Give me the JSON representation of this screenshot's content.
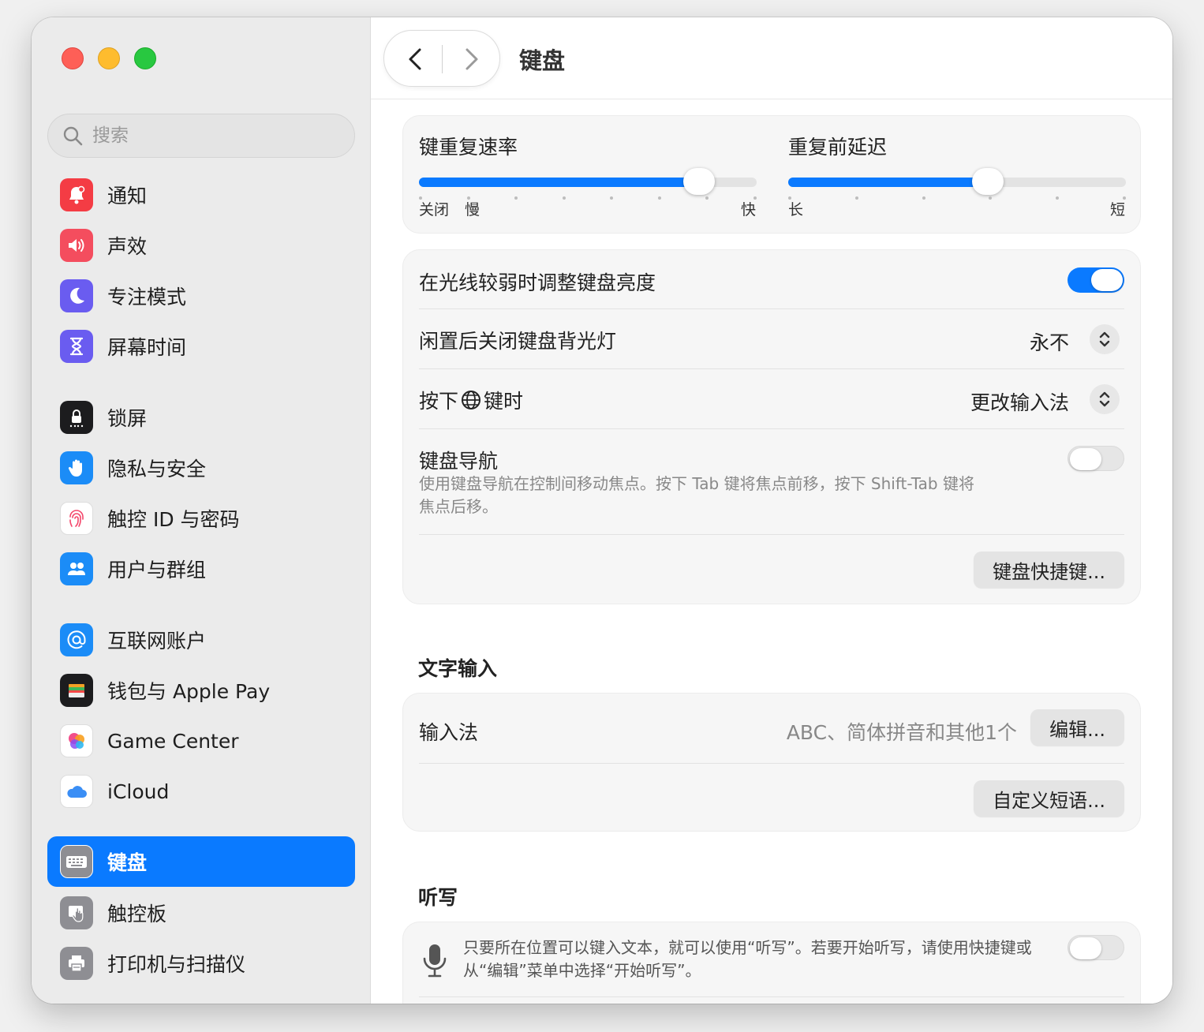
{
  "page": {
    "title": "键盘"
  },
  "search": {
    "placeholder": "搜索"
  },
  "sidebar": {
    "items": [
      {
        "label": "通知",
        "icon": "bell-icon",
        "color": "#f43c44"
      },
      {
        "label": "声效",
        "icon": "speaker-icon",
        "color": "#f44d5e"
      },
      {
        "label": "专注模式",
        "icon": "moon-icon",
        "color": "#6a5cf0"
      },
      {
        "label": "屏幕时间",
        "icon": "hourglass-icon",
        "color": "#6a5cf0"
      },
      {
        "label": "锁屏",
        "icon": "lock-icon",
        "color": "#1c1c1e"
      },
      {
        "label": "隐私与安全",
        "icon": "hand-icon",
        "color": "#1b8cf7"
      },
      {
        "label": "触控 ID 与密码",
        "icon": "fingerprint-icon",
        "color": "#ffffff"
      },
      {
        "label": "用户与群组",
        "icon": "users-icon",
        "color": "#1b8cf7"
      },
      {
        "label": "互联网账户",
        "icon": "at-icon",
        "color": "#1b8cf7"
      },
      {
        "label": "钱包与 Apple Pay",
        "icon": "wallet-icon",
        "color": "#1c1c1e"
      },
      {
        "label": "Game Center",
        "icon": "game-center-icon",
        "color": "#ffffff"
      },
      {
        "label": "iCloud",
        "icon": "cloud-icon",
        "color": "#ffffff"
      },
      {
        "label": "键盘",
        "icon": "keyboard-icon",
        "color": "#8e8e93",
        "selected": true
      },
      {
        "label": "触控板",
        "icon": "trackpad-icon",
        "color": "#8e8e93"
      },
      {
        "label": "打印机与扫描仪",
        "icon": "printer-icon",
        "color": "#8e8e93"
      }
    ]
  },
  "repeat": {
    "rate": {
      "title": "键重复速率",
      "label_off": "关闭",
      "label_slow": "慢",
      "label_fast": "快",
      "value_fraction": 0.83
    },
    "delay": {
      "title": "重复前延迟",
      "label_long": "长",
      "label_short": "短",
      "value_fraction": 0.59
    }
  },
  "settings": {
    "brightness": {
      "label": "在光线较弱时调整键盘亮度",
      "on": true
    },
    "backlight": {
      "label": "闲置后关闭键盘背光灯",
      "value": "永不"
    },
    "globe": {
      "label_before": "按下",
      "label_after": "键时",
      "value": "更改输入法"
    },
    "navigation": {
      "label": "键盘导航",
      "desc": "使用键盘导航在控制间移动焦点。按下 Tab 键将焦点前移，按下 Shift-Tab 键将焦点后移。",
      "on": false
    },
    "shortcuts_button": "键盘快捷键..."
  },
  "text_input": {
    "title": "文字输入",
    "input_label": "输入法",
    "input_value": "ABC、简体拼音和其他1个",
    "edit_button": "编辑...",
    "replacements_button": "自定义短语..."
  },
  "dictation": {
    "title": "听写",
    "desc": "只要所在位置可以键入文本，就可以使用“听写”。若要开始听写，请使用快捷键或从“编辑”菜单中选择“开始听写”。",
    "on": false
  },
  "colors": {
    "accent": "#0a7aff"
  }
}
